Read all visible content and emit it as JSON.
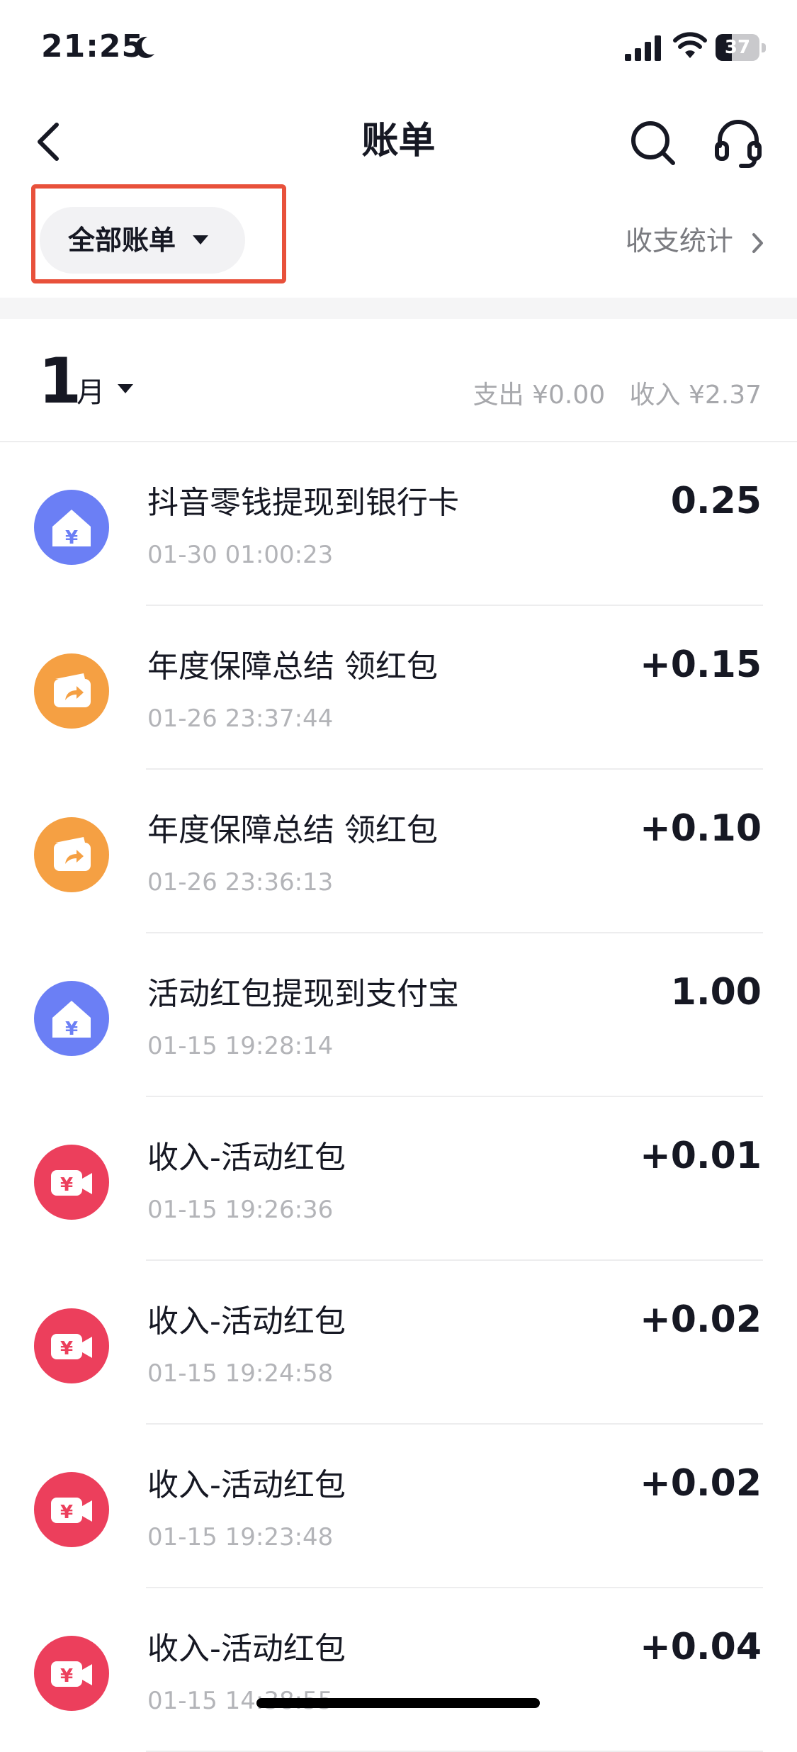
{
  "status_bar": {
    "time": "21:25",
    "battery_level": "37",
    "battery_fraction": 0.37,
    "icons": [
      "moon-icon",
      "signal-icon",
      "wifi-icon",
      "battery-icon"
    ]
  },
  "nav": {
    "title": "账单",
    "icons": [
      "back-icon",
      "search-icon",
      "headset-icon"
    ]
  },
  "filter": {
    "label": "全部账单",
    "stats_link": "收支统计",
    "highlight_color": "#e8513b"
  },
  "month": {
    "number": "1",
    "unit": "月",
    "expense_label": "支出",
    "expense_value": "¥0.00",
    "income_label": "收入",
    "income_value": "¥2.37"
  },
  "transactions": [
    {
      "title": "抖音零钱提现到银行卡",
      "time": "01-30 01:00:23",
      "amount": "0.25",
      "icon": "withdraw-icon",
      "color": "#6b7ff5"
    },
    {
      "title": "年度保障总结 领红包",
      "time": "01-26 23:37:44",
      "amount": "+0.15",
      "icon": "wallet-share-icon",
      "color": "#f5a043"
    },
    {
      "title": "年度保障总结 领红包",
      "time": "01-26 23:36:13",
      "amount": "+0.10",
      "icon": "wallet-share-icon",
      "color": "#f5a043"
    },
    {
      "title": "活动红包提现到支付宝",
      "time": "01-15 19:28:14",
      "amount": "1.00",
      "icon": "withdraw-icon",
      "color": "#6b7ff5"
    },
    {
      "title": "收入-活动红包",
      "time": "01-15 19:26:36",
      "amount": "+0.01",
      "icon": "video-money-icon",
      "color": "#ec3f5c"
    },
    {
      "title": "收入-活动红包",
      "time": "01-15 19:24:58",
      "amount": "+0.02",
      "icon": "video-money-icon",
      "color": "#ec3f5c"
    },
    {
      "title": "收入-活动红包",
      "time": "01-15 19:23:48",
      "amount": "+0.02",
      "icon": "video-money-icon",
      "color": "#ec3f5c"
    },
    {
      "title": "收入-活动红包",
      "time": "01-15 14:38:55",
      "amount": "+0.04",
      "icon": "video-money-icon",
      "color": "#ec3f5c"
    }
  ]
}
